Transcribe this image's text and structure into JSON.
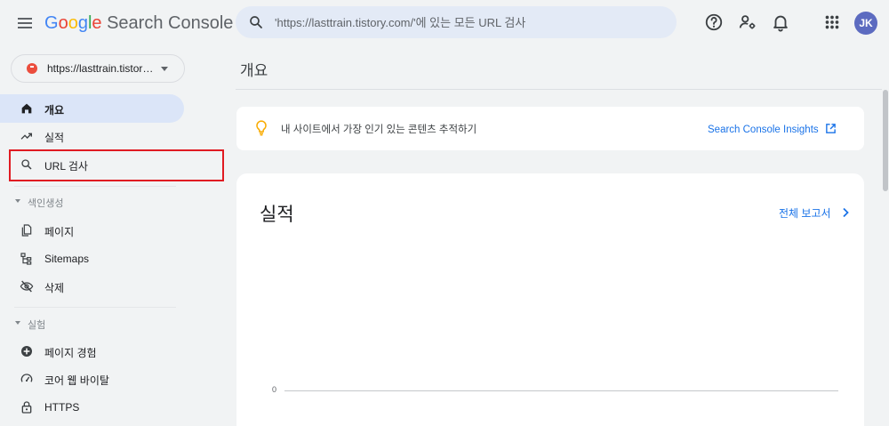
{
  "header": {
    "logo": {
      "G": "G",
      "o1": "o",
      "o2": "o",
      "g": "g",
      "l": "l",
      "e": "e",
      "product": "Search Console"
    },
    "search_placeholder": "'https://lasttrain.tistory.com/'에 있는 모든 URL 검사",
    "avatar_initials": "JK",
    "icons": [
      "menu-icon",
      "search-icon",
      "help-icon",
      "manage-users-icon",
      "notifications-icon",
      "apps-grid-icon"
    ]
  },
  "sidebar": {
    "property": "https://lasttrain.tistory.com/",
    "items": [
      {
        "label": "개요",
        "icon": "home-icon",
        "active": true
      },
      {
        "label": "실적",
        "icon": "trending-up-icon",
        "active": false
      },
      {
        "label": "URL 검사",
        "icon": "search-icon",
        "active": false
      }
    ],
    "sections": [
      {
        "title": "색인생성",
        "items": [
          {
            "label": "페이지",
            "icon": "pages-icon"
          },
          {
            "label": "Sitemaps",
            "icon": "sitemap-icon"
          },
          {
            "label": "삭제",
            "icon": "visibility-off-icon"
          }
        ]
      },
      {
        "title": "실험",
        "items": [
          {
            "label": "페이지 경험",
            "icon": "add-circle-icon"
          },
          {
            "label": "코어 웹 바이탈",
            "icon": "speed-gauge-icon"
          },
          {
            "label": "HTTPS",
            "icon": "lock-icon"
          }
        ]
      }
    ]
  },
  "main": {
    "page_title": "개요",
    "insights": {
      "text": "내 사이트에서 가장 인기 있는 콘텐츠 추적하기",
      "link": "Search Console Insights",
      "icon": "lightbulb-icon"
    },
    "performance": {
      "title": "실적",
      "report_link": "전체 보고서"
    }
  },
  "colors": {
    "accent": "#1a73e8",
    "active_nav_bg": "#dbe5f8",
    "highlight_border": "#e01b22",
    "background": "#f1f3f4"
  },
  "chart_data": {
    "type": "line",
    "title": "",
    "xlabel": "",
    "ylabel": "",
    "y_ticks": [
      "0"
    ],
    "series": []
  }
}
